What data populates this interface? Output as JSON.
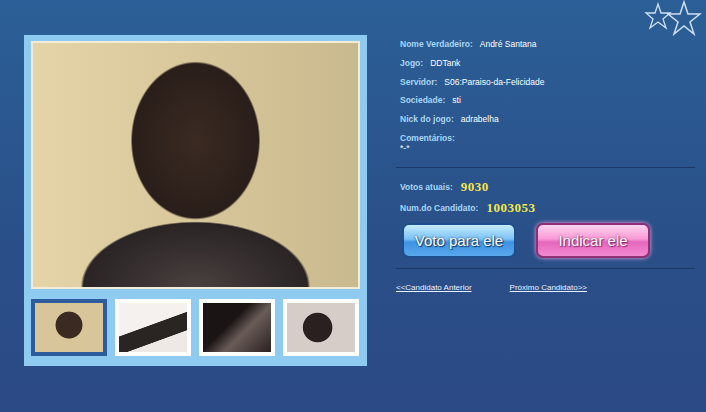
{
  "profile": {
    "fields": [
      {
        "label": "Nome Verdadeiro:",
        "value": "André Santana"
      },
      {
        "label": "Jogo:",
        "value": "DDTank"
      },
      {
        "label": "Servidor:",
        "value": "S06:Paraiso-da-Felicidade"
      },
      {
        "label": "Sociedade:",
        "value": "sti"
      },
      {
        "label": "Nick do jogo:",
        "value": "adrabelha"
      }
    ],
    "comments": {
      "label": "Comentários:",
      "value": "*-*"
    }
  },
  "stats": [
    {
      "label": "Votos atuais:",
      "value": "9030"
    },
    {
      "label": "Num.do Candidato:",
      "value": "1003053"
    }
  ],
  "buttons": [
    {
      "label": "Voto para ele",
      "kind": "vote"
    },
    {
      "label": "Indicar ele",
      "kind": "nominate"
    }
  ],
  "nav": [
    "<<Candidato Anterior",
    "Próximo Candidato>>"
  ],
  "thumbnails": [
    {
      "selected": true
    },
    {
      "selected": false
    },
    {
      "selected": false
    },
    {
      "selected": false
    }
  ]
}
